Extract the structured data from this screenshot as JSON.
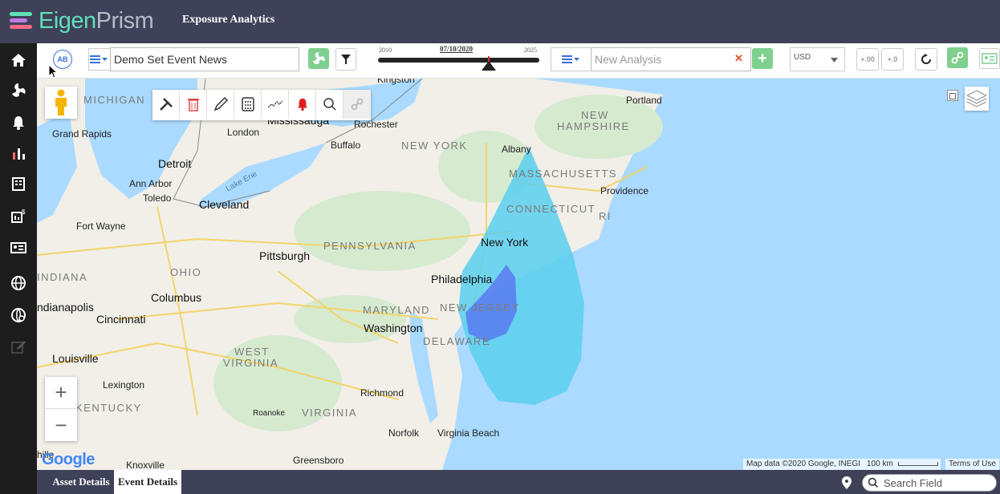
{
  "header": {
    "logo_part1": "Eigen",
    "logo_part2": "Prism",
    "app_title": "Exposure Analytics"
  },
  "colors": {
    "header_bg": "#3f4158",
    "sidebar_bg": "#1d1d1d",
    "accent_green": "#7fd08f",
    "accent_blue": "#3a6fd6",
    "event_cone": "#5bcfee",
    "event_core": "#5a7ff0"
  },
  "sidebar": {
    "items": [
      {
        "icon": "home-icon"
      },
      {
        "icon": "hazard-icon"
      },
      {
        "icon": "bell-icon"
      },
      {
        "icon": "analytics-icon"
      },
      {
        "icon": "building-icon"
      },
      {
        "icon": "finance-icon"
      },
      {
        "icon": "id-card-icon"
      },
      {
        "icon": "globe-icon"
      },
      {
        "icon": "globe-settings-icon"
      },
      {
        "icon": "edit-icon"
      }
    ]
  },
  "toolbar": {
    "ab_label": "AB",
    "event_set_value": "Demo Set Event News",
    "timeline": {
      "start_label": "2010",
      "end_label": "2025",
      "current_date": "07/10/2020"
    },
    "analysis_placeholder": "New Analysis",
    "clear_symbol": "✕",
    "add_symbol": "+",
    "currency": "USD",
    "decimal_increase": "+.00",
    "decimal_decrease": "+.0"
  },
  "map": {
    "states": [
      {
        "id": "michigan",
        "label": "MICHIGAN"
      },
      {
        "id": "new-york",
        "label": "NEW YORK"
      },
      {
        "id": "massachusetts",
        "label": "MASSACHUSETTS"
      },
      {
        "id": "new-hampshire-1",
        "label": "NEW"
      },
      {
        "id": "new-hampshire-2",
        "label": "HAMPSHIRE"
      },
      {
        "id": "connecticut",
        "label": "CONNECTICUT"
      },
      {
        "id": "ri",
        "label": "RI"
      },
      {
        "id": "pennsylvania",
        "label": "PENNSYLVANIA"
      },
      {
        "id": "ohio",
        "label": "OHIO"
      },
      {
        "id": "indiana",
        "label": "INDIANA"
      },
      {
        "id": "maryland",
        "label": "MARYLAND"
      },
      {
        "id": "new-jersey",
        "label": "NEW JERSEY"
      },
      {
        "id": "delaware",
        "label": "DELAWARE"
      },
      {
        "id": "west-virginia-1",
        "label": "WEST"
      },
      {
        "id": "west-virginia-2",
        "label": "VIRGINIA"
      },
      {
        "id": "virginia",
        "label": "VIRGINIA"
      },
      {
        "id": "kentucky",
        "label": "KENTUCKY"
      }
    ],
    "cities": [
      {
        "id": "kingston",
        "label": "Kingston"
      },
      {
        "id": "mississauga",
        "label": "Mississauga"
      },
      {
        "id": "rochester",
        "label": "Rochester"
      },
      {
        "id": "grand-rapids",
        "label": "Grand Rapids"
      },
      {
        "id": "london",
        "label": "London"
      },
      {
        "id": "buffalo",
        "label": "Buffalo"
      },
      {
        "id": "albany",
        "label": "Albany"
      },
      {
        "id": "portland",
        "label": "Portland"
      },
      {
        "id": "detroit",
        "label": "Detroit"
      },
      {
        "id": "ann-arbor",
        "label": "Ann Arbor"
      },
      {
        "id": "toledo",
        "label": "Toledo"
      },
      {
        "id": "cleveland",
        "label": "Cleveland"
      },
      {
        "id": "providence",
        "label": "Providence"
      },
      {
        "id": "fort-wayne",
        "label": "Fort Wayne"
      },
      {
        "id": "new-york-city",
        "label": "New York"
      },
      {
        "id": "pittsburgh",
        "label": "Pittsburgh"
      },
      {
        "id": "philadelphia",
        "label": "Philadelphia"
      },
      {
        "id": "columbus",
        "label": "Columbus"
      },
      {
        "id": "indianapolis",
        "label": "ndianapolis"
      },
      {
        "id": "cincinnati",
        "label": "Cincinnati"
      },
      {
        "id": "washington",
        "label": "Washington"
      },
      {
        "id": "louisville",
        "label": "Louisville"
      },
      {
        "id": "lexington",
        "label": "Lexington"
      },
      {
        "id": "richmond",
        "label": "Richmond"
      },
      {
        "id": "roanoke",
        "label": "Roanoke"
      },
      {
        "id": "norfolk",
        "label": "Norfolk"
      },
      {
        "id": "virginia-beach",
        "label": "Virginia Beach"
      },
      {
        "id": "knoxville",
        "label": "Knoxville"
      },
      {
        "id": "greensboro",
        "label": "Greensboro"
      },
      {
        "id": "nashville-partial",
        "label": "hille"
      }
    ],
    "water": {
      "lake_erie": "Lake Erie"
    },
    "google_logo": "Google",
    "attribution": {
      "map_data": "Map data ©2020 Google, INEGI",
      "scale": "100 km",
      "terms": "Terms of Use"
    },
    "zoom_in": "+",
    "zoom_out": "−"
  },
  "footer": {
    "tabs": [
      {
        "label": "Asset Details",
        "active": false
      },
      {
        "label": "Event Details",
        "active": true
      }
    ],
    "search_placeholder": "Search Field"
  }
}
